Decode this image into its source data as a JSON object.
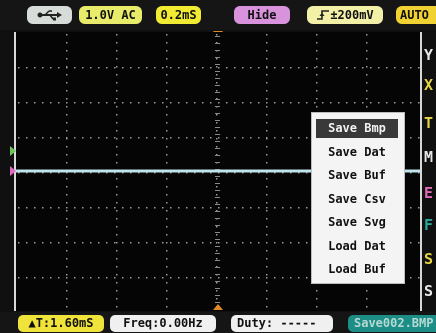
{
  "top": {
    "usb_icon": "usb-icon",
    "channel": "1.0V AC",
    "timebase": "0.2mS",
    "hide": "Hide",
    "trigger": "±200mV",
    "trigger_icon": "rising-edge-icon",
    "mode": "AUTO"
  },
  "side_menu": [
    "Y",
    "X",
    "T",
    "M",
    "E",
    "F",
    "S",
    "S"
  ],
  "popup_menu": {
    "items": [
      "Save Bmp",
      "Save Dat",
      "Save Buf",
      "Save Csv",
      "Save Svg",
      "Load Dat",
      "Load Buf"
    ],
    "selected": "Save Bmp"
  },
  "bottom": {
    "delta_t": "▲T:1.60mS",
    "freq": "Freq:0.00Hz",
    "duty": "Duty: -----",
    "save": "Save002.BMP"
  },
  "colors": {
    "trace": "#bfe4ec",
    "grid_dots": "#9a9a9a",
    "selected_menu_bg": "#393939",
    "save_chip": "#1c8e86"
  }
}
